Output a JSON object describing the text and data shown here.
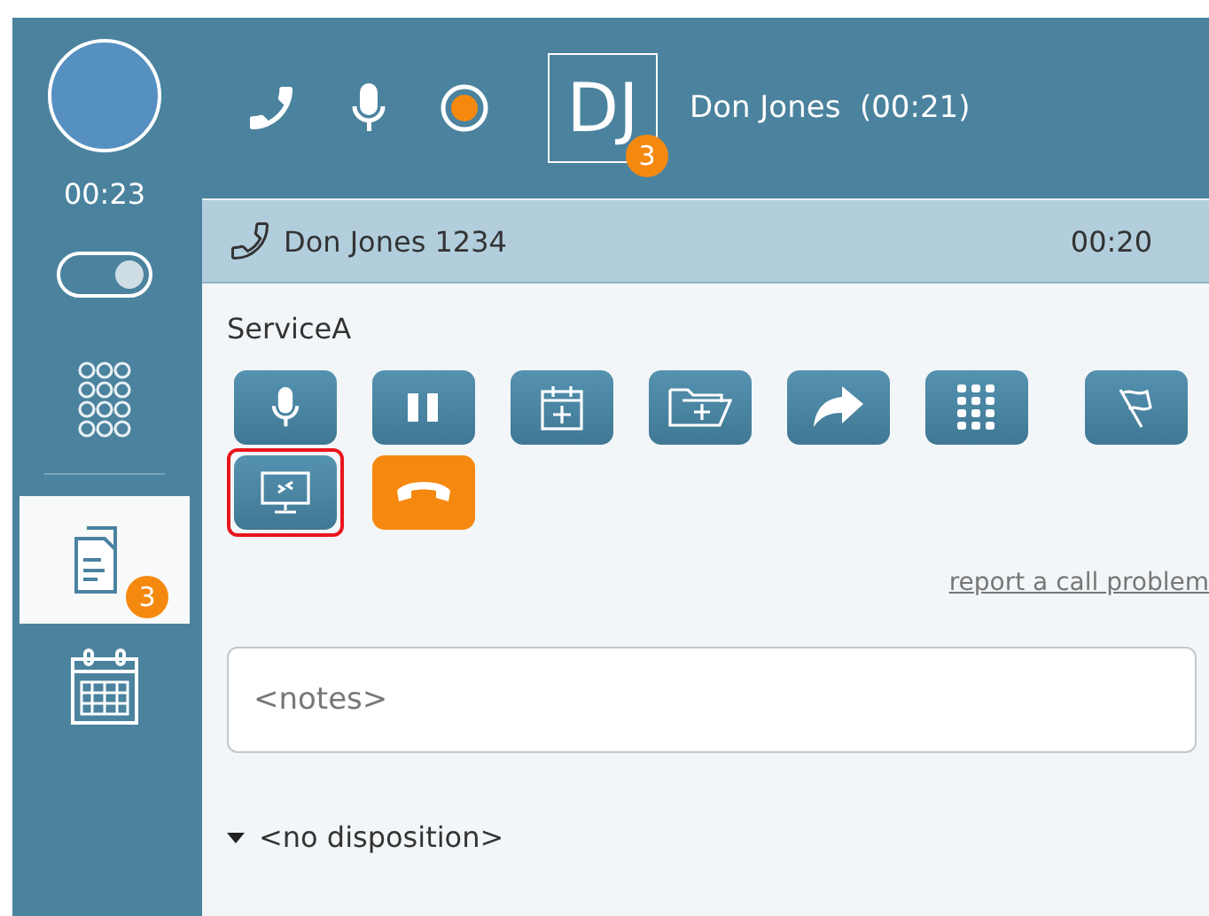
{
  "sidebar": {
    "timer": "00:23",
    "items": [
      {
        "kind": "toggle",
        "on": true,
        "selected": false
      },
      {
        "kind": "keypad",
        "selected": false
      },
      {
        "kind": "documents",
        "selected": true,
        "badge": "3"
      },
      {
        "kind": "calendar",
        "selected": false
      }
    ]
  },
  "top_bar": {
    "contact_initials": "DJ",
    "contact_badge": "3",
    "contact_label": "Don Jones  (00:21)"
  },
  "call": {
    "title": "Don Jones 1234",
    "duration": "00:20",
    "service": "ServiceA",
    "buttons": [
      {
        "kind": "mute",
        "selected": false
      },
      {
        "kind": "hold",
        "selected": false
      },
      {
        "kind": "schedule",
        "selected": false
      },
      {
        "kind": "folder",
        "selected": false
      },
      {
        "kind": "transfer",
        "selected": false
      },
      {
        "kind": "keypad",
        "selected": false
      },
      {
        "kind": "flag",
        "selected": false
      },
      {
        "kind": "screen",
        "selected": true
      },
      {
        "kind": "hangup",
        "selected": false
      }
    ],
    "report_link": "report a call problem",
    "notes": {
      "placeholder": "<notes>"
    },
    "disposition": "<no disposition>"
  }
}
